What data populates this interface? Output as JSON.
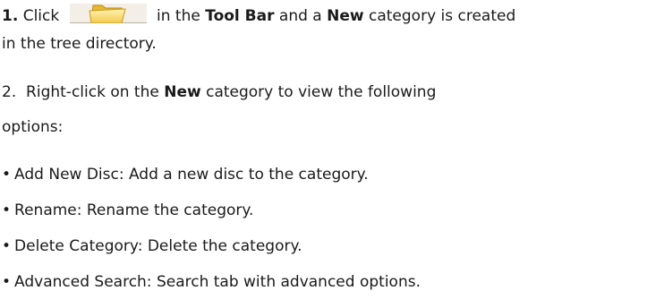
{
  "step1": {
    "number": "1.",
    "before": " Click ",
    "after": " in the ",
    "bold1": "Tool Bar",
    "mid": " and a ",
    "bold2": "New",
    "end": " category is created",
    "cont": "in the tree directory.",
    "icon": "new-folder-icon"
  },
  "step2": {
    "number": "2.",
    "before": "  Right-click on the ",
    "bold": "New",
    "after": " category to view the following",
    "cont": "options:"
  },
  "options": [
    "Add New Disc: Add a new disc to the category.",
    "Rename: Rename the category.",
    "Delete Category: Delete the category.",
    "Advanced Search: Search tab with advanced options."
  ],
  "bullet": "•"
}
